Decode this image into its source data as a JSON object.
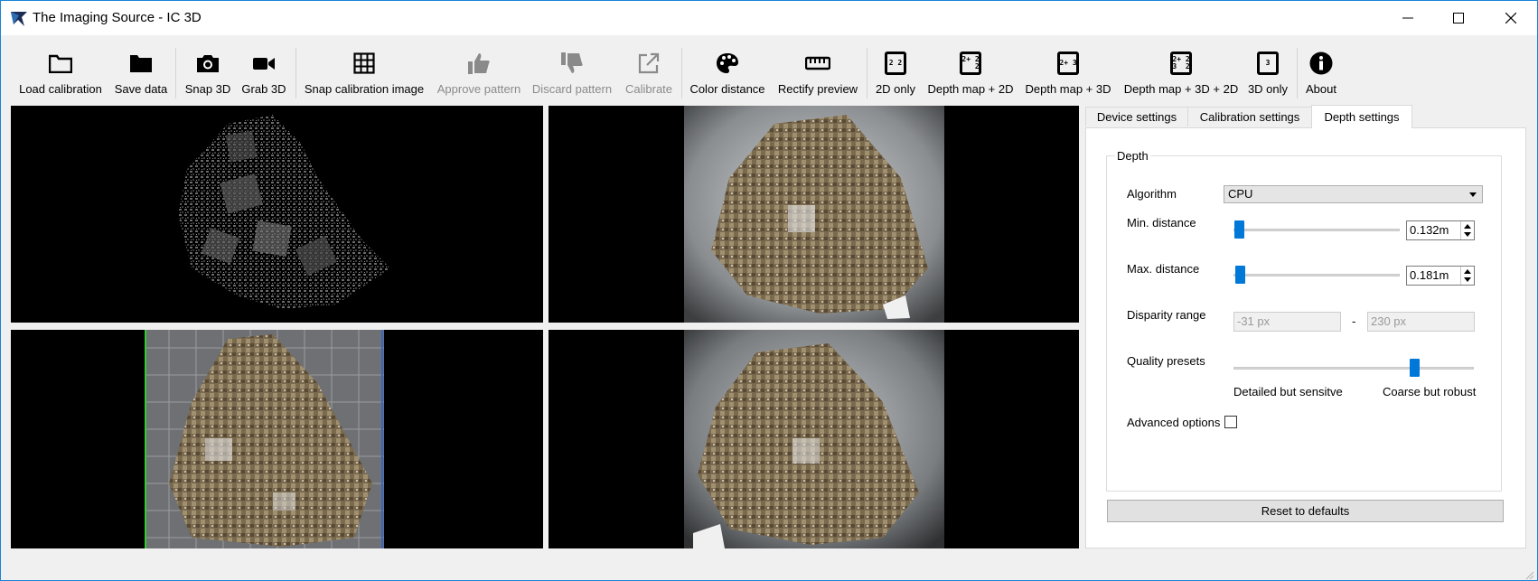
{
  "window": {
    "title": "The Imaging Source - IC 3D"
  },
  "window_controls": {
    "minimize": "─",
    "maximize": "☐",
    "close": "✕"
  },
  "toolbar": {
    "buttons": [
      {
        "label": "Load calibration",
        "icon": "folder-open-icon",
        "enabled": true
      },
      {
        "label": "Save data",
        "icon": "folder-icon",
        "enabled": true
      },
      {
        "label": "Snap 3D",
        "icon": "camera-icon",
        "enabled": true
      },
      {
        "label": "Grab 3D",
        "icon": "video-camera-icon",
        "enabled": true
      },
      {
        "label": "Snap calibration image",
        "icon": "grid-icon",
        "enabled": true
      },
      {
        "label": "Approve pattern",
        "icon": "thumbs-up-icon",
        "enabled": false
      },
      {
        "label": "Discard pattern",
        "icon": "thumbs-down-icon",
        "enabled": false
      },
      {
        "label": "Calibrate",
        "icon": "external-edit-icon",
        "enabled": false
      },
      {
        "label": "Color distance",
        "icon": "palette-icon",
        "enabled": true
      },
      {
        "label": "Rectify preview",
        "icon": "ruler-icon",
        "enabled": true
      },
      {
        "label": "2D only",
        "icon": "view-2d-icon",
        "icon_text": "2 2",
        "enabled": true
      },
      {
        "label": "Depth map + 2D",
        "icon": "view-depth-2d-icon",
        "icon_text": "2+ 2\n   2",
        "enabled": true
      },
      {
        "label": "Depth map + 3D",
        "icon": "view-depth-3d-icon",
        "icon_text": "2+ 3",
        "enabled": true
      },
      {
        "label": "Depth map + 3D + 2D",
        "icon": "view-depth-3d-2d-icon",
        "icon_text": "2+ 2\n3  2",
        "enabled": true
      },
      {
        "label": "3D only",
        "icon": "view-3d-icon",
        "icon_text": "3",
        "enabled": true
      },
      {
        "label": "About",
        "icon": "info-icon",
        "enabled": true
      }
    ]
  },
  "tabs": [
    {
      "label": "Device settings",
      "active": false
    },
    {
      "label": "Calibration settings",
      "active": false
    },
    {
      "label": "Depth settings",
      "active": true
    }
  ],
  "depth": {
    "group_title": "Depth",
    "algorithm": {
      "label": "Algorithm",
      "value": "CPU"
    },
    "min_distance": {
      "label": "Min. distance",
      "value": "0.132m",
      "slider_fraction": 0.02
    },
    "max_distance": {
      "label": "Max. distance",
      "value": "0.181m",
      "slider_fraction": 0.02
    },
    "disparity": {
      "label": "Disparity range",
      "min": "-31 px",
      "separator": "-",
      "max": "230 px"
    },
    "quality": {
      "label": "Quality presets",
      "left_label": "Detailed but sensitve",
      "right_label": "Coarse but robust",
      "slider_fraction": 0.74
    },
    "advanced": {
      "label": "Advanced options",
      "checked": false
    }
  },
  "reset_label": "Reset to defaults",
  "colors": {
    "accent": "#0078d7",
    "window_border": "#1883d7"
  }
}
